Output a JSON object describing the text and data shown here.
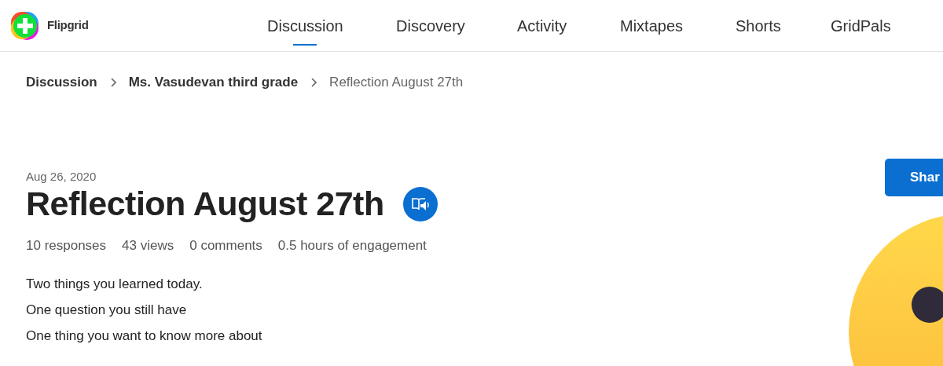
{
  "brand": {
    "name": "Flipgrid"
  },
  "nav": [
    {
      "label": "Discussion",
      "selected": true
    },
    {
      "label": "Discovery",
      "selected": false
    },
    {
      "label": "Activity",
      "selected": false
    },
    {
      "label": "Mixtapes",
      "selected": false
    },
    {
      "label": "Shorts",
      "selected": false
    },
    {
      "label": "GridPals",
      "selected": false
    }
  ],
  "breadcrumb": [
    {
      "label": "Discussion",
      "current": false
    },
    {
      "label": "Ms. Vasudevan third grade",
      "current": false
    },
    {
      "label": "Reflection August 27th",
      "current": true
    }
  ],
  "topic": {
    "date": "Aug 26, 2020",
    "title": "Reflection August 27th",
    "stats": [
      "10 responses",
      "43 views",
      "0 comments",
      "0.5 hours of engagement"
    ],
    "prompt": [
      "Two things you learned today.",
      "One question you still have",
      "One thing you want to know more about"
    ]
  },
  "share_button": {
    "label": "Shar"
  }
}
